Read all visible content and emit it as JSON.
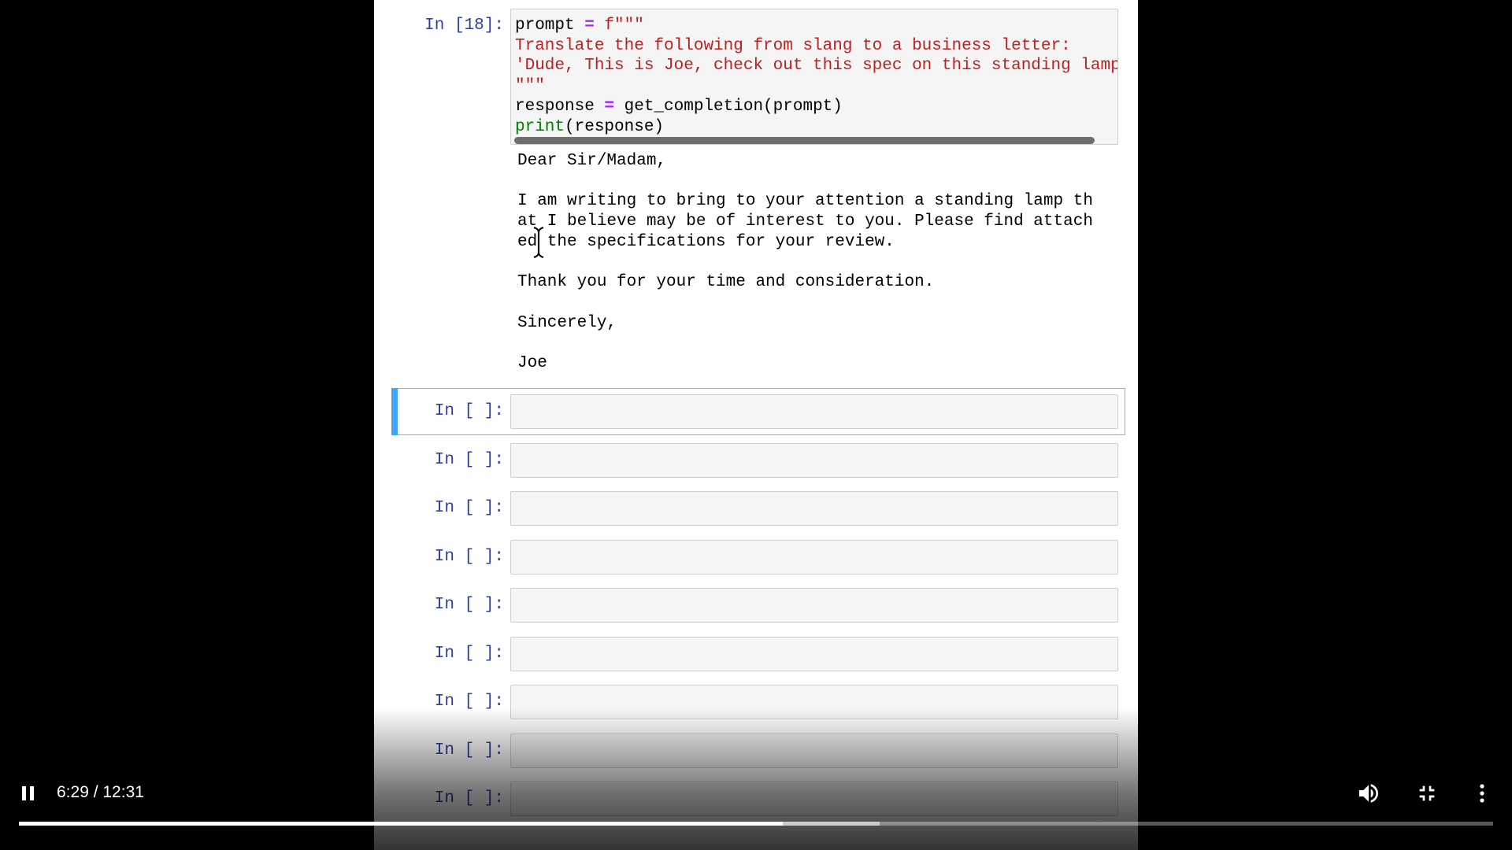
{
  "notebook": {
    "executed_cell": {
      "prompt": "In [18]:",
      "code_lines": [
        [
          {
            "t": "prompt ",
            "c": ""
          },
          {
            "t": "=",
            "c": "kw-op"
          },
          {
            "t": " f\"\"\"",
            "c": "str"
          }
        ],
        [
          {
            "t": "Translate the following from slang to a business letter:",
            "c": "str"
          }
        ],
        [
          {
            "t": "'Dude, This is Joe, check out this spec on this standing lamp",
            "c": "str"
          }
        ],
        [
          {
            "t": "\"\"\"",
            "c": "str"
          }
        ],
        [
          {
            "t": "response ",
            "c": ""
          },
          {
            "t": "=",
            "c": "kw-op"
          },
          {
            "t": " get_completion(prompt)",
            "c": ""
          }
        ],
        [
          {
            "t": "print",
            "c": "builtin"
          },
          {
            "t": "(response)",
            "c": ""
          }
        ]
      ],
      "output": "Dear Sir/Madam,\n\nI am writing to bring to your attention a standing lamp th\nat I believe may be of interest to you. Please find attach\ned the specifications for your review.\n\nThank you for your time and consideration.\n\nSincerely,\n\nJoe"
    },
    "empty_cells": [
      {
        "prompt": "In [ ]:",
        "selected": true
      },
      {
        "prompt": "In [ ]:"
      },
      {
        "prompt": "In [ ]:"
      },
      {
        "prompt": "In [ ]:"
      },
      {
        "prompt": "In [ ]:"
      },
      {
        "prompt": "In [ ]:"
      },
      {
        "prompt": "In [ ]:"
      },
      {
        "prompt": "In [ ]:"
      },
      {
        "prompt": "In [ ]:"
      }
    ]
  },
  "player": {
    "time_display": "6:29 / 12:31",
    "progress_fraction": 0.518,
    "buffered_fraction": 0.584,
    "icons": {
      "play_pause": "pause-icon",
      "volume": "volume-icon",
      "fullscreen": "exit-fullscreen-icon",
      "more": "more-vert-icon"
    }
  }
}
